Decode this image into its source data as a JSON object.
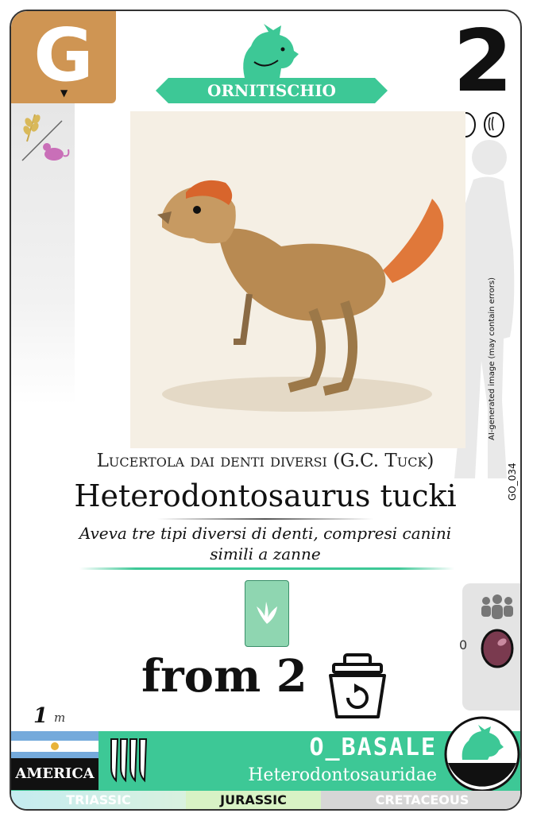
{
  "card": {
    "letter": "G",
    "letter_marker": "▼",
    "clade": "ORNITISCHIO",
    "number": "2",
    "eggs": 2,
    "diet_icons": [
      "wheat-icon",
      "mouse-icon"
    ],
    "common_name": "Lucertola dai denti diversi (G.C. Tuck)",
    "scientific_name": "Heterodontosaurus tucki",
    "description": "Aveva tre tipi diversi di denti, compresi canini simili a zanne",
    "ai_note": "AI-generated image (may contain errors)",
    "code": "GO_034",
    "from_text": "from 2",
    "group_count": "0",
    "height_value": "1",
    "height_unit": "m",
    "region": "AMERICA",
    "group_name": "O_BASALE",
    "family": "Heterodontosauridae",
    "periods": [
      "TRIASSIC",
      "JURASSIC",
      "CRETACEOUS"
    ],
    "active_period": "JURASSIC"
  },
  "colors": {
    "letter_bg": "#cf9553",
    "clade_green": "#3dc896",
    "track_card": "#8fd6b1",
    "gem": "#7a3a4f",
    "flag_blue": "#75aadb"
  }
}
